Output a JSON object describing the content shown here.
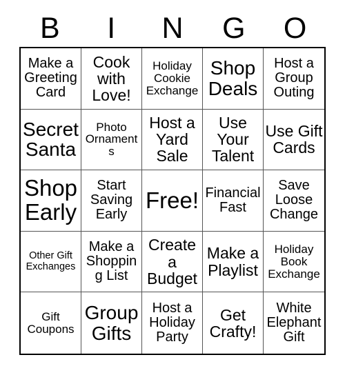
{
  "header": {
    "letters": [
      "B",
      "I",
      "N",
      "G",
      "O"
    ]
  },
  "grid": {
    "rows": 5,
    "columns": 5,
    "free_space": "Free!",
    "cells": [
      {
        "text": "Make a Greeting Card",
        "size": "m"
      },
      {
        "text": "Cook with Love!",
        "size": "l"
      },
      {
        "text": "Holiday Cookie Exchange",
        "size": "s"
      },
      {
        "text": "Shop Deals",
        "size": "xl"
      },
      {
        "text": "Host a Group Outing",
        "size": "m"
      },
      {
        "text": "Secret Santa",
        "size": "xl"
      },
      {
        "text": "Photo Ornaments",
        "size": "s"
      },
      {
        "text": "Host a Yard Sale",
        "size": "l"
      },
      {
        "text": "Use Your Talent",
        "size": "l"
      },
      {
        "text": "Use Gift Cards",
        "size": "l"
      },
      {
        "text": "Shop Early",
        "size": "xxl"
      },
      {
        "text": "Start Saving Early",
        "size": "m"
      },
      {
        "text": "Free!",
        "size": "xxl"
      },
      {
        "text": "Financial Fast",
        "size": "m"
      },
      {
        "text": "Save Loose Change",
        "size": "m"
      },
      {
        "text": "Other Gift Exchanges",
        "size": "xs"
      },
      {
        "text": "Make a Shopping List",
        "size": "m"
      },
      {
        "text": "Create a Budget",
        "size": "l"
      },
      {
        "text": "Make a Playlist",
        "size": "l"
      },
      {
        "text": "Holiday Book Exchange",
        "size": "s"
      },
      {
        "text": "Gift Coupons",
        "size": "s"
      },
      {
        "text": "Group Gifts",
        "size": "xl"
      },
      {
        "text": "Host a Holiday Party",
        "size": "m"
      },
      {
        "text": "Get Crafty!",
        "size": "l"
      },
      {
        "text": "White Elephant Gift",
        "size": "m"
      }
    ]
  }
}
